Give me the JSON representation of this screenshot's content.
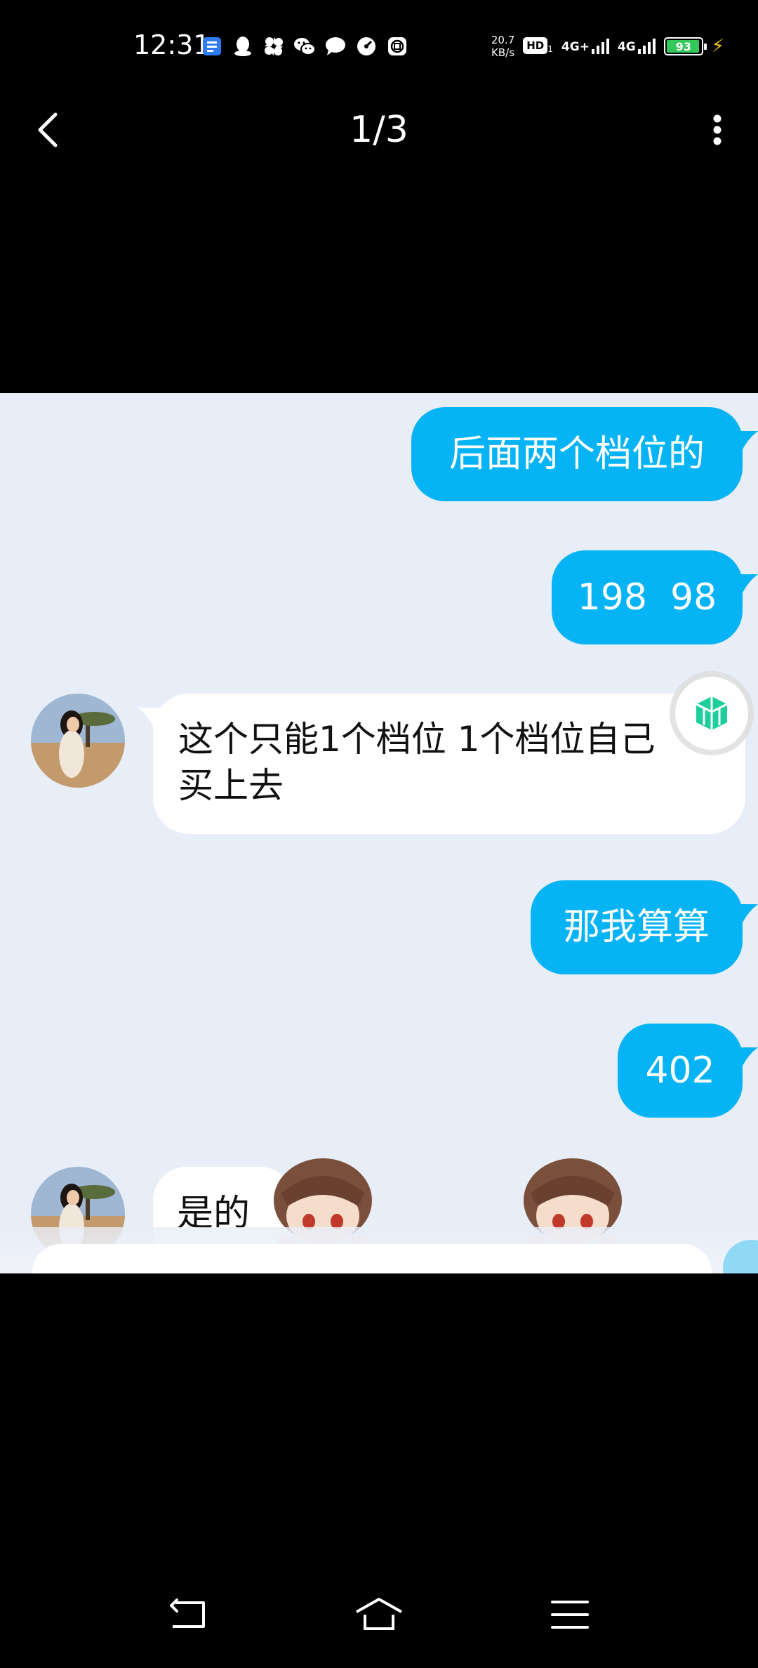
{
  "status_bar": {
    "time": "12:31",
    "net_speed_value": "20.7",
    "net_speed_unit": "KB/s",
    "hd_label": "HD",
    "hd_sub": "1",
    "network_1": "4G+",
    "network_2": "4G",
    "battery_level": "93",
    "icons": [
      "app-store-icon",
      "qq-icon",
      "pinwheel-icon",
      "wechat-icon",
      "message-icon",
      "speedometer-icon",
      "bank-icon"
    ]
  },
  "viewer": {
    "page_counter": "1/3",
    "back_icon": "chevron-left-icon",
    "more_icon": "more-vertical-icon"
  },
  "chat": {
    "messages": [
      {
        "side": "out",
        "text": "后面两个档位的"
      },
      {
        "side": "out",
        "text": "198  98"
      },
      {
        "side": "in",
        "line1": "这个只能1个档位 1个档位自己",
        "line2": "买上去"
      },
      {
        "side": "out",
        "text": "那我算算"
      },
      {
        "side": "out",
        "text": "402"
      },
      {
        "side": "in",
        "text": "是的"
      }
    ],
    "colors": {
      "background": "#e8eef7",
      "outgoing_bubble": "#06b3f5",
      "incoming_bubble": "#ffffff"
    }
  },
  "system_nav": {
    "back_icon": "back-arrow-icon",
    "home_icon": "home-icon",
    "menu_icon": "menu-icon"
  }
}
